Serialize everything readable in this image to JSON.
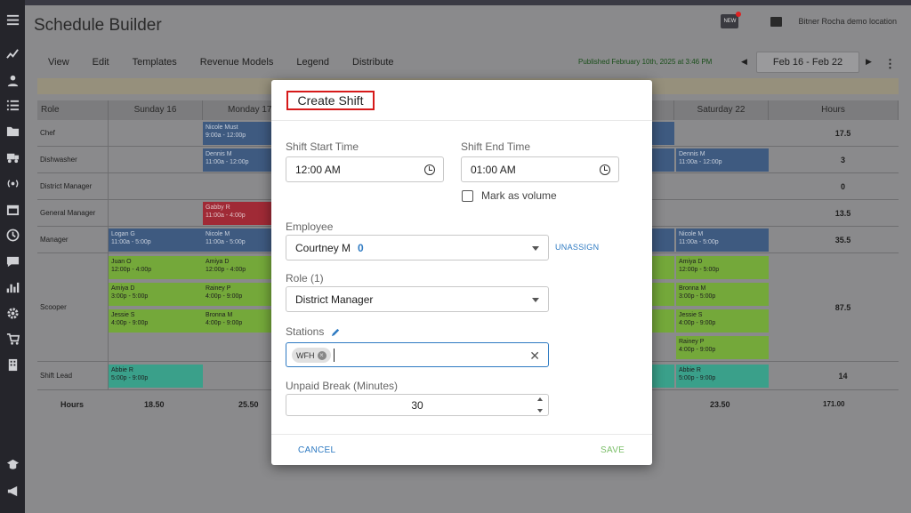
{
  "app": {
    "title": "Schedule Builder",
    "location": "Bitner Rocha demo location",
    "new_badge": "NEW"
  },
  "menu": {
    "items": [
      "View",
      "Edit",
      "Templates",
      "Revenue Models",
      "Legend",
      "Distribute"
    ],
    "published": "Published February 10th, 2025 at 3:46 PM",
    "date_range": "Feb 16 - Feb 22"
  },
  "grid": {
    "headers": [
      "Role",
      "Sunday 16",
      "Monday 17",
      "Saturday 22",
      "Hours"
    ],
    "rows": [
      {
        "role": "Chef",
        "hours": "17.5"
      },
      {
        "role": "Dishwasher",
        "hours": "3"
      },
      {
        "role": "District Manager",
        "hours": "0"
      },
      {
        "role": "General Manager",
        "hours": "13.5"
      },
      {
        "role": "Manager",
        "hours": "35.5"
      },
      {
        "role": "Scooper",
        "hours": "87.5"
      },
      {
        "role": "Shift Lead",
        "hours": "14"
      }
    ],
    "shifts": {
      "chef_mon": {
        "name": "Nicole Must",
        "time": "9:00a - 12:00p"
      },
      "dish_mon": {
        "name": "Dennis M",
        "time": "11:00a - 12:00p"
      },
      "dish_sat": {
        "name": "Dennis M",
        "time": "11:00a - 12:00p"
      },
      "gm_mon": {
        "name": "Gabby R",
        "time": "11:00a - 4:00p"
      },
      "mgr_sun": {
        "name": "Logan G",
        "time": "11:00a - 5:00p"
      },
      "mgr_mon": {
        "name": "Nicole M",
        "time": "11:00a - 5:00p"
      },
      "mgr_sat": {
        "name": "Nicole M",
        "time": "11:00a - 5:00p"
      },
      "sc1_sun": {
        "name": "Juan O",
        "time": "12:00p - 4:00p"
      },
      "sc1_mon": {
        "name": "Amiya D",
        "time": "12:00p - 4:00p"
      },
      "sc1_sat": {
        "name": "Amiya D",
        "time": "12:00p - 5:00p"
      },
      "sc2_sun": {
        "name": "Amiya D",
        "time": "3:00p - 5:00p"
      },
      "sc2_mon": {
        "name": "Rainey P",
        "time": "4:00p - 9:00p"
      },
      "sc2_sat": {
        "name": "Bronna M",
        "time": "3:00p - 5:00p"
      },
      "sc3_sun": {
        "name": "Jessie S",
        "time": "4:00p - 9:00p"
      },
      "sc3_mon": {
        "name": "Bronna M",
        "time": "4:00p - 9:00p"
      },
      "sc3_sat": {
        "name": "Jessie S",
        "time": "4:00p - 9:00p"
      },
      "sc4_sat": {
        "name": "Rainey P",
        "time": "4:00p - 9:00p"
      },
      "sl_sun": {
        "name": "Abbie R",
        "time": "5:00p - 9:00p"
      },
      "sl_sat": {
        "name": "Abbie R",
        "time": "5:00p - 9:00p"
      }
    },
    "footer": {
      "label": "Hours",
      "sun": "18.50",
      "mon": "25.50",
      "sat": "23.50",
      "total": "171.00"
    }
  },
  "modal": {
    "title": "Create Shift",
    "start_label": "Shift Start Time",
    "start_value": "12:00 AM",
    "end_label": "Shift End Time",
    "end_value": "01:00 AM",
    "volume_label": "Mark as volume",
    "employee_label": "Employee",
    "employee_value": "Courtney M",
    "employee_count": "0",
    "unassign": "UNASSIGN",
    "role_label": "Role (1)",
    "role_value": "District Manager",
    "stations_label": "Stations",
    "station_chip": "WFH",
    "break_label": "Unpaid Break (Minutes)",
    "break_value": "30",
    "cancel": "CANCEL",
    "save": "SAVE"
  },
  "colors": {
    "accent_blue": "#2e7ac2",
    "save_green": "#7cbf6a",
    "highlight_red": "#d61a1a",
    "shift_blue": "#3e5a80",
    "shift_green": "#74a83a",
    "shift_red": "#a02a36",
    "shift_teal": "#3aa08a"
  },
  "icons": {
    "sidebar": [
      "menu-icon",
      "trend-icon",
      "people-icon",
      "list-icon",
      "folder-icon",
      "truck-icon",
      "broadcast-icon",
      "calendar-icon",
      "clock-icon",
      "chat-icon",
      "chart-icon",
      "gear-icon",
      "cart-icon",
      "building-icon",
      "graduation-icon",
      "megaphone-icon"
    ]
  }
}
